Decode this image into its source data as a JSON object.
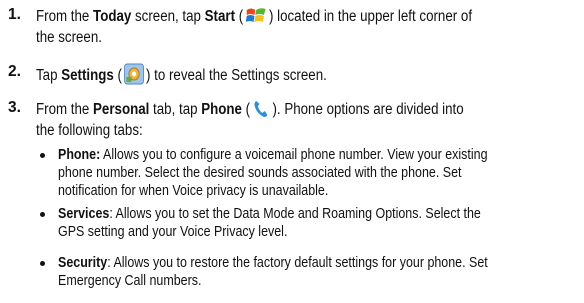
{
  "steps": [
    {
      "num": "1.",
      "line1_a": "From the ",
      "line1_b1": "Today",
      "line1_c": " screen, tap ",
      "line1_b2": "Start",
      "line1_d": " (",
      "line1_e": ") located in the upper left corner of",
      "line2": "the screen.",
      "icon": "windows-start-icon"
    },
    {
      "num": "2.",
      "line1_a": "Tap ",
      "line1_b1": "Settings",
      "line1_d": " (",
      "line1_e": ") to reveal the Settings screen.",
      "icon": "settings-icon"
    },
    {
      "num": "3.",
      "line1_a": "From the ",
      "line1_b1": "Personal",
      "line1_c": " tab, tap ",
      "line1_b2": "Phone",
      "line1_d": " (",
      "line1_e": "). Phone options are divided into",
      "line2": "the following tabs:",
      "icon": "phone-icon"
    }
  ],
  "bullets": [
    {
      "title": "Phone:",
      "lines": [
        " Allows you to configure a voicemail phone number. View your existing",
        "phone number. Select the desired sounds associated with the phone. Set",
        "notification for when Voice privacy is unavailable."
      ]
    },
    {
      "title": "Services",
      "lines": [
        ": Allows you to set the Data Mode and Roaming Options. Select the",
        "GPS setting and your Voice Privacy level."
      ]
    },
    {
      "title": "Security",
      "lines": [
        ": Allows you to restore the factory default settings for your phone. Set",
        "Emergency Call numbers."
      ]
    }
  ],
  "colors": {
    "text": "#111111",
    "phone_icon": "#2a8fd8"
  }
}
